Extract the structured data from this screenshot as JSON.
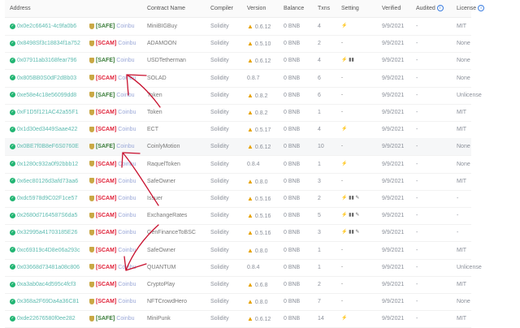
{
  "header": {
    "address": "Address",
    "contract_name": "Contract Name",
    "compiler": "Compiler",
    "version": "Version",
    "balance": "Balance",
    "txns": "Txns",
    "setting": "Setting",
    "verified": "Verified",
    "audited": "Audited",
    "license": "License",
    "info_glyph": "i"
  },
  "coinbu_label": "Coinbu",
  "rows": [
    {
      "address": "0x0e2c66461-4c9fa0b6",
      "tag": "[SAFE]",
      "name": "MiniBIGBuy",
      "compiler": "Solidity",
      "version": "0.6.12",
      "warn": true,
      "balance": "0 BNB",
      "txns": "4",
      "setting": "⚡",
      "verified": "9/9/2021",
      "audited": "-",
      "license": "MIT"
    },
    {
      "address": "0x8498Sf3c18834f1a752",
      "tag": "[SCAM]",
      "name": "ADAMOON",
      "compiler": "Solidity",
      "version": "0.5.10",
      "warn": true,
      "balance": "0 BNB",
      "txns": "2",
      "setting": "-",
      "verified": "9/9/2021",
      "audited": "-",
      "license": "None"
    },
    {
      "address": "0x07911ab3168fear796",
      "tag": "[SAFE]",
      "name": "USDTetherman",
      "compiler": "Solidity",
      "version": "0.6.12",
      "warn": true,
      "balance": "0 BNB",
      "txns": "4",
      "setting": "⚡ ▮▮",
      "verified": "9/9/2021",
      "audited": "-",
      "license": "None"
    },
    {
      "address": "0x805BB0S0dF2dBb03",
      "tag": "[SCAM]",
      "name": "SOLAD",
      "compiler": "Solidity",
      "version": "0.8.7",
      "warn": false,
      "balance": "0 BNB",
      "txns": "6",
      "setting": "-",
      "verified": "9/9/2021",
      "audited": "-",
      "license": "None"
    },
    {
      "address": "0xe58e4c18e56099dd8",
      "tag": "[SAFE]",
      "name": "Token",
      "compiler": "Solidity",
      "version": "0.8.2",
      "warn": true,
      "balance": "0 BNB",
      "txns": "6",
      "setting": "-",
      "verified": "9/9/2021",
      "audited": "-",
      "license": "Unlicense"
    },
    {
      "address": "0xF1D5f121AC42a55F1",
      "tag": "[SCAM]",
      "name": "Token",
      "compiler": "Solidity",
      "version": "0.8.2",
      "warn": true,
      "balance": "0 BNB",
      "txns": "1",
      "setting": "-",
      "verified": "9/9/2021",
      "audited": "-",
      "license": "MIT"
    },
    {
      "address": "0x1d30ed3449Saae422",
      "tag": "[SCAM]",
      "name": "ECT",
      "compiler": "Solidity",
      "version": "0.5.17",
      "warn": true,
      "balance": "0 BNB",
      "txns": "4",
      "setting": "⚡",
      "verified": "9/9/2021",
      "audited": "-",
      "license": "MIT"
    },
    {
      "address": "0x0BE7f0B8eF6S0760E",
      "tag": "[SAFE]",
      "name": "CoinlyMotion",
      "compiler": "Solidity",
      "version": "0.6.12",
      "warn": true,
      "balance": "0 BNB",
      "txns": "10",
      "setting": "-",
      "verified": "9/9/2021",
      "audited": "-",
      "license": "None"
    },
    {
      "address": "0x1280c932a0f92bbb12",
      "tag": "[SCAM]",
      "name": "RaquelToken",
      "compiler": "Solidity",
      "version": "0.8.4",
      "warn": false,
      "balance": "0 BNB",
      "txns": "1",
      "setting": "⚡",
      "verified": "9/9/2021",
      "audited": "-",
      "license": "None"
    },
    {
      "address": "0x6ec80126d3afd73aa6",
      "tag": "[SCAM]",
      "name": "SafeOwner",
      "compiler": "Solidity",
      "version": "0.8.0",
      "warn": true,
      "balance": "0 BNB",
      "txns": "3",
      "setting": "-",
      "verified": "9/9/2021",
      "audited": "-",
      "license": "MIT"
    },
    {
      "address": "0xdc5978d9C02F1ce57",
      "tag": "[SCAM]",
      "name": "Issuer",
      "compiler": "Solidity",
      "version": "0.5.16",
      "warn": true,
      "balance": "0 BNB",
      "txns": "2",
      "setting": "⚡ ▮▮ ✎",
      "verified": "9/9/2021",
      "audited": "-",
      "license": "-"
    },
    {
      "address": "0x2680d7164587S6da5",
      "tag": "[SCAM]",
      "name": "ExchangeRates",
      "compiler": "Solidity",
      "version": "0.5.16",
      "warn": true,
      "balance": "0 BNB",
      "txns": "5",
      "setting": "⚡ ▮▮ ✎",
      "verified": "9/9/2021",
      "audited": "-",
      "license": "-"
    },
    {
      "address": "0x32995a41703185E26",
      "tag": "[SCAM]",
      "name": "GenFinanceToBSC",
      "compiler": "Solidity",
      "version": "0.5.16",
      "warn": true,
      "balance": "0 BNB",
      "txns": "3",
      "setting": "⚡ ▮▮ ✎",
      "verified": "9/9/2021",
      "audited": "-",
      "license": "-"
    },
    {
      "address": "0xc69319c4D8e06a293c",
      "tag": "[SCAM]",
      "name": "SafeOwner",
      "compiler": "Solidity",
      "version": "0.8.0",
      "warn": true,
      "balance": "0 BNB",
      "txns": "1",
      "setting": "-",
      "verified": "9/9/2021",
      "audited": "-",
      "license": "MIT"
    },
    {
      "address": "0x03668d73481a08c806",
      "tag": "[SCAM]",
      "name": "QUANTUM",
      "compiler": "Solidity",
      "version": "0.8.4",
      "warn": false,
      "balance": "0 BNB",
      "txns": "1",
      "setting": "-",
      "verified": "9/9/2021",
      "audited": "-",
      "license": "Unlicense"
    },
    {
      "address": "0xa3ab0ac4d595c4fcf3",
      "tag": "[SCAM]",
      "name": "CryptoPlay",
      "compiler": "Solidity",
      "version": "0.6.8",
      "warn": true,
      "balance": "0 BNB",
      "txns": "2",
      "setting": "-",
      "verified": "9/9/2021",
      "audited": "-",
      "license": "MIT"
    },
    {
      "address": "0x368a2F69Da4a36C81",
      "tag": "[SCAM]",
      "name": "NFTCrowdHero",
      "compiler": "Solidity",
      "version": "0.8.0",
      "warn": true,
      "balance": "0 BNB",
      "txns": "7",
      "setting": "-",
      "verified": "9/9/2021",
      "audited": "-",
      "license": "None"
    },
    {
      "address": "0xde22676580f0ee282",
      "tag": "[SAFE]",
      "name": "MiniPunk",
      "compiler": "Solidity",
      "version": "0.6.12",
      "warn": true,
      "balance": "0 BNB",
      "txns": "14",
      "setting": "⚡",
      "verified": "9/9/2021",
      "audited": "-",
      "license": "MIT"
    }
  ],
  "colors": {
    "safe": "#3a7d3a",
    "scam": "#e0233a",
    "verified_check": "#22b573",
    "warning": "#e6a100",
    "annotation": "#c8102e"
  }
}
